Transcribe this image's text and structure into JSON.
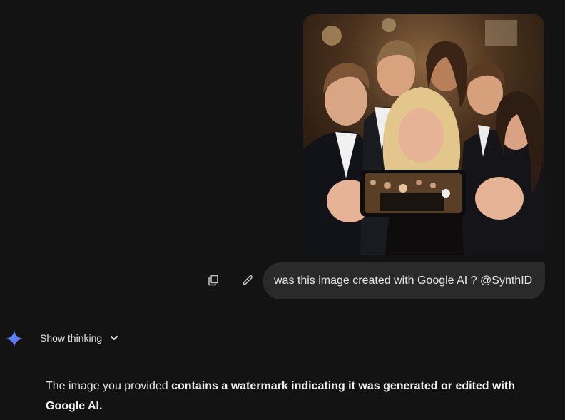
{
  "conversation": {
    "user_message": {
      "text": "was this image created with Google AI ? @SynthID",
      "image_alt": "Group selfie of people in formal wear at an event"
    },
    "message_actions": {
      "copy_icon": "copy-icon",
      "edit_icon": "pencil-icon"
    },
    "assistant": {
      "spark_icon": "gemini-spark-icon",
      "show_thinking_label": "Show thinking",
      "chevron_icon": "chevron-down-icon",
      "response": {
        "part1": "The image you provided ",
        "part2_bold": "contains a watermark indicating it was generated or edited with Google AI."
      }
    }
  },
  "colors": {
    "background": "#131314",
    "bubble": "#2a2a2b",
    "text": "#e3e3e3",
    "spark_blue": "#4e8cf5"
  }
}
